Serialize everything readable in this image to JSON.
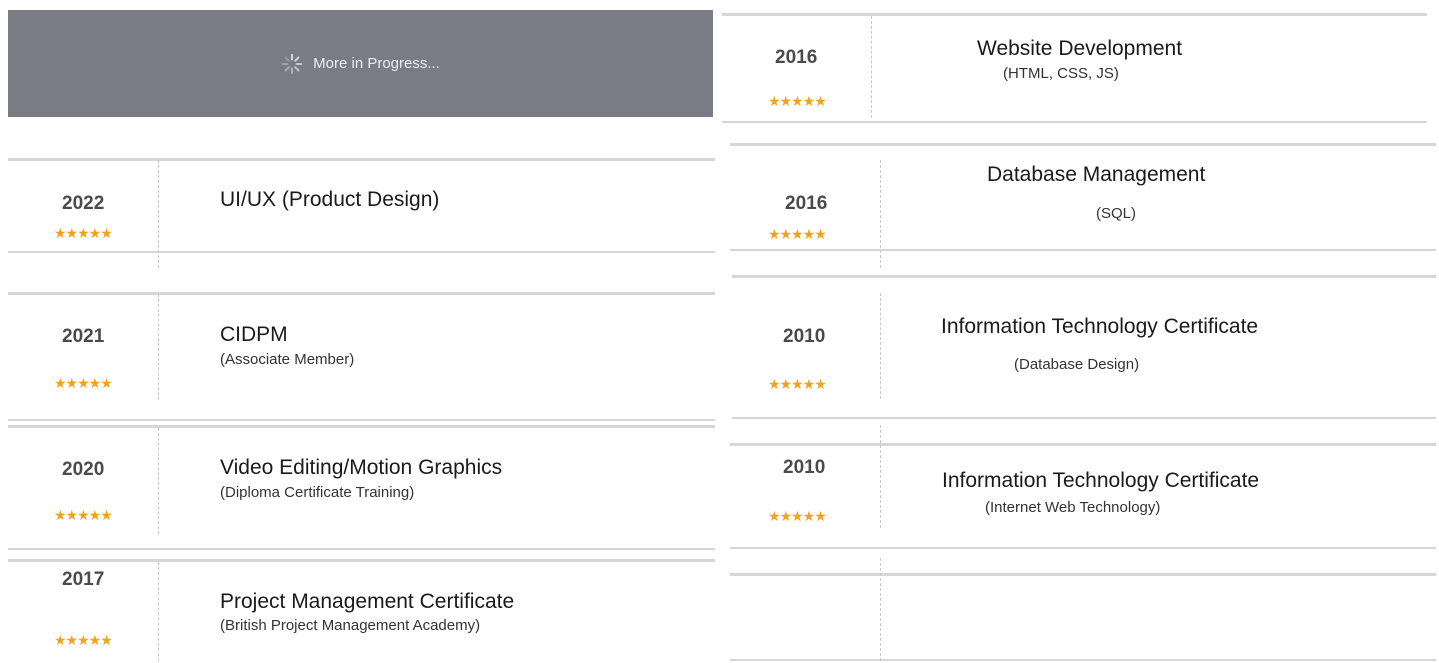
{
  "progress_banner": {
    "icon": "spinner-icon",
    "text": "More in Progress..."
  },
  "star_glyph": "★★★★★",
  "left_column": [
    {
      "year": "2022",
      "title": "UI/UX (Product Design)",
      "subtitle": "",
      "rating": 5
    },
    {
      "year": "2021",
      "title": "CIDPM",
      "subtitle": "(Associate Member)",
      "rating": 5
    },
    {
      "year": "2020",
      "title": "Video Editing/Motion Graphics",
      "subtitle": "(Diploma Certificate Training)",
      "rating": 5
    },
    {
      "year": "2017",
      "title": "Project Management Certificate",
      "subtitle": "(British Project Management Academy)",
      "rating": 5
    }
  ],
  "right_column": [
    {
      "year": "2016",
      "title": "Website Development",
      "subtitle": "(HTML, CSS, JS)",
      "rating": 5
    },
    {
      "year": "2016",
      "title": "Database Management",
      "subtitle": "(SQL)",
      "rating": 5
    },
    {
      "year": "2010",
      "title": "Information Technology Certificate",
      "subtitle": "(Database Design)",
      "rating": 5
    },
    {
      "year": "2010",
      "title": "Information Technology Certificate",
      "subtitle": "(Internet Web Technology)",
      "rating": 5
    },
    {
      "year": "",
      "title": "",
      "subtitle": "",
      "rating": 0
    }
  ],
  "colors": {
    "banner_bg": "#7b7b85",
    "banner_text": "#ececf0",
    "star": "#f5a21b",
    "divider": "#d6d6d6"
  }
}
